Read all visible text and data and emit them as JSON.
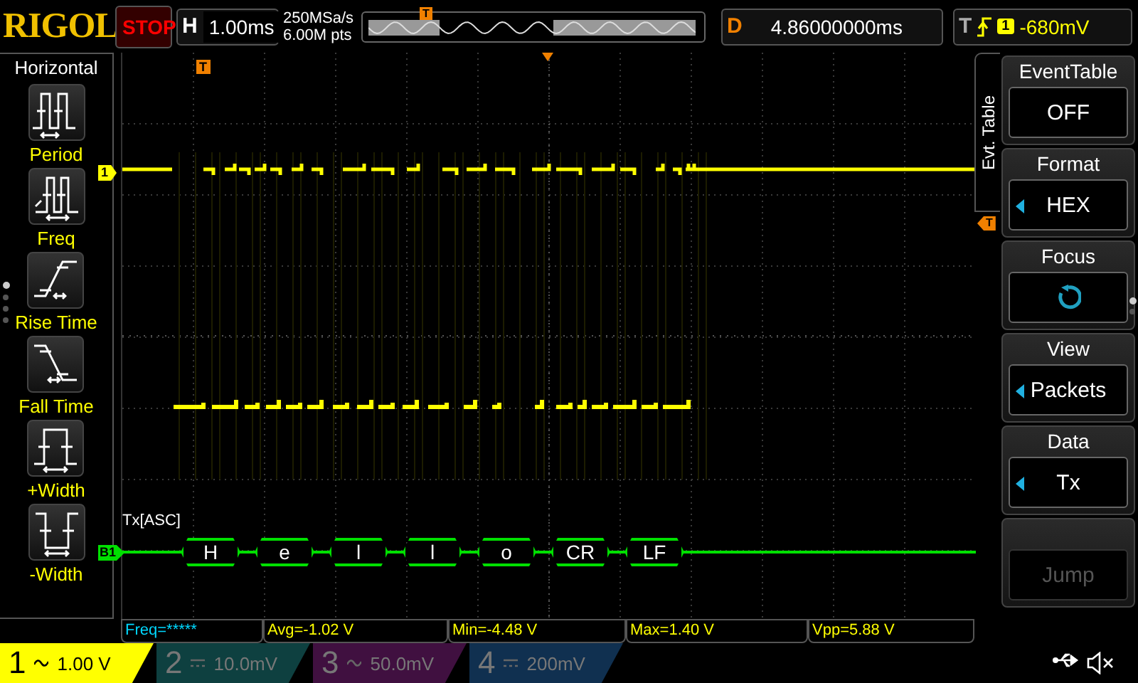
{
  "top_bar": {
    "logo": "RIGOL",
    "run_state": "STOP",
    "horizontal": {
      "label": "H",
      "timebase": "1.00ms"
    },
    "sample_rate": "250MSa/s",
    "memory_depth": "6.00M pts",
    "memory_marker": "T",
    "delay": {
      "label": "D",
      "value": "4.86000000ms"
    },
    "trigger": {
      "label": "T",
      "source": "1",
      "level": "-680mV"
    }
  },
  "left_menu": {
    "title": "Horizontal",
    "items": [
      {
        "kind": "period",
        "label": "Period"
      },
      {
        "kind": "freq",
        "label": "Freq"
      },
      {
        "kind": "rise",
        "label": "Rise Time"
      },
      {
        "kind": "fall",
        "label": "Fall Time"
      },
      {
        "kind": "pwidth",
        "label": "+Width"
      },
      {
        "kind": "nwidth",
        "label": "-Width"
      }
    ],
    "pages": [
      {
        "selected": true
      },
      {
        "selected": false
      },
      {
        "selected": false
      },
      {
        "selected": false
      }
    ]
  },
  "screen": {
    "trigger_marker": "T",
    "channel_marker": "1",
    "bus_marker": "B1",
    "bus_label": "Tx[ASC]",
    "packets": [
      "H",
      "e",
      "l",
      "l",
      "o",
      "CR",
      "LF"
    ]
  },
  "right_menu": {
    "tab": "Evt. Table",
    "trigger_marker": "T",
    "items": [
      {
        "title": "EventTable",
        "kind": "text",
        "value": "OFF",
        "arrow": false,
        "disabled": false
      },
      {
        "title": "Format",
        "kind": "text",
        "value": "HEX",
        "arrow": true,
        "disabled": false
      },
      {
        "title": "Focus",
        "kind": "icon",
        "arrow": false,
        "disabled": false
      },
      {
        "title": "View",
        "kind": "text",
        "value": "Packets",
        "arrow": true,
        "disabled": false
      },
      {
        "title": "Data",
        "kind": "text",
        "value": "Tx",
        "arrow": true,
        "disabled": false
      },
      {
        "kind": "text",
        "value": "Jump",
        "arrow": false,
        "disabled": true
      }
    ],
    "pages": [
      {
        "selected": true
      },
      {
        "selected": false
      }
    ]
  },
  "measurements": [
    {
      "text": "Freq=*****",
      "invalid": true
    },
    {
      "text": "Avg=-1.02 V",
      "invalid": false
    },
    {
      "text": "Min=-4.48 V",
      "invalid": false
    },
    {
      "text": "Max=1.40 V",
      "invalid": false
    },
    {
      "text": "Vpp=5.88 V",
      "invalid": false
    }
  ],
  "channels": [
    {
      "label": "1",
      "kind": "ac",
      "scale": "1.00 V",
      "on": true,
      "color": "#ffff00"
    },
    {
      "label": "2",
      "kind": "dc",
      "scale": "10.0mV",
      "on": false,
      "color": "#0e4040"
    },
    {
      "label": "3",
      "kind": "ac",
      "scale": "50.0mV",
      "on": false,
      "color": "#401040"
    },
    {
      "label": "4",
      "kind": "dc",
      "scale": "200mV",
      "on": false,
      "color": "#103050"
    }
  ]
}
